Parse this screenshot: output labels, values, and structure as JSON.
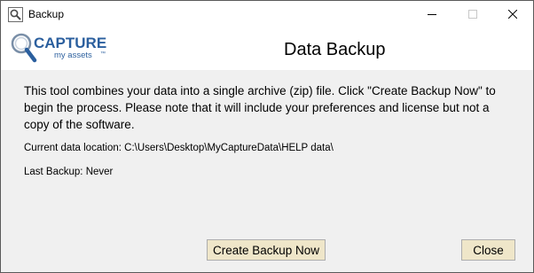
{
  "window": {
    "title": "Backup"
  },
  "logo": {
    "brand_main": "CAPTURE",
    "brand_sub": "my assets",
    "trademark": "™"
  },
  "header": {
    "title": "Data Backup"
  },
  "content": {
    "description": "This tool combines your data into a single archive (zip) file. Click \"Create Backup Now\" to begin the process. Please note that it will include your preferences and license but not a copy of the software.",
    "location_label": "Current data location:",
    "location_value": "C:\\Users\\Desktop\\MyCaptureData\\HELP data\\",
    "last_backup_label": "Last Backup:",
    "last_backup_value": "Never"
  },
  "buttons": {
    "create_backup": "Create Backup Now",
    "close": "Close"
  },
  "colors": {
    "brand_blue": "#2b5f9e",
    "button_face": "#efe6c9",
    "window_bg": "#f0f0f0"
  }
}
